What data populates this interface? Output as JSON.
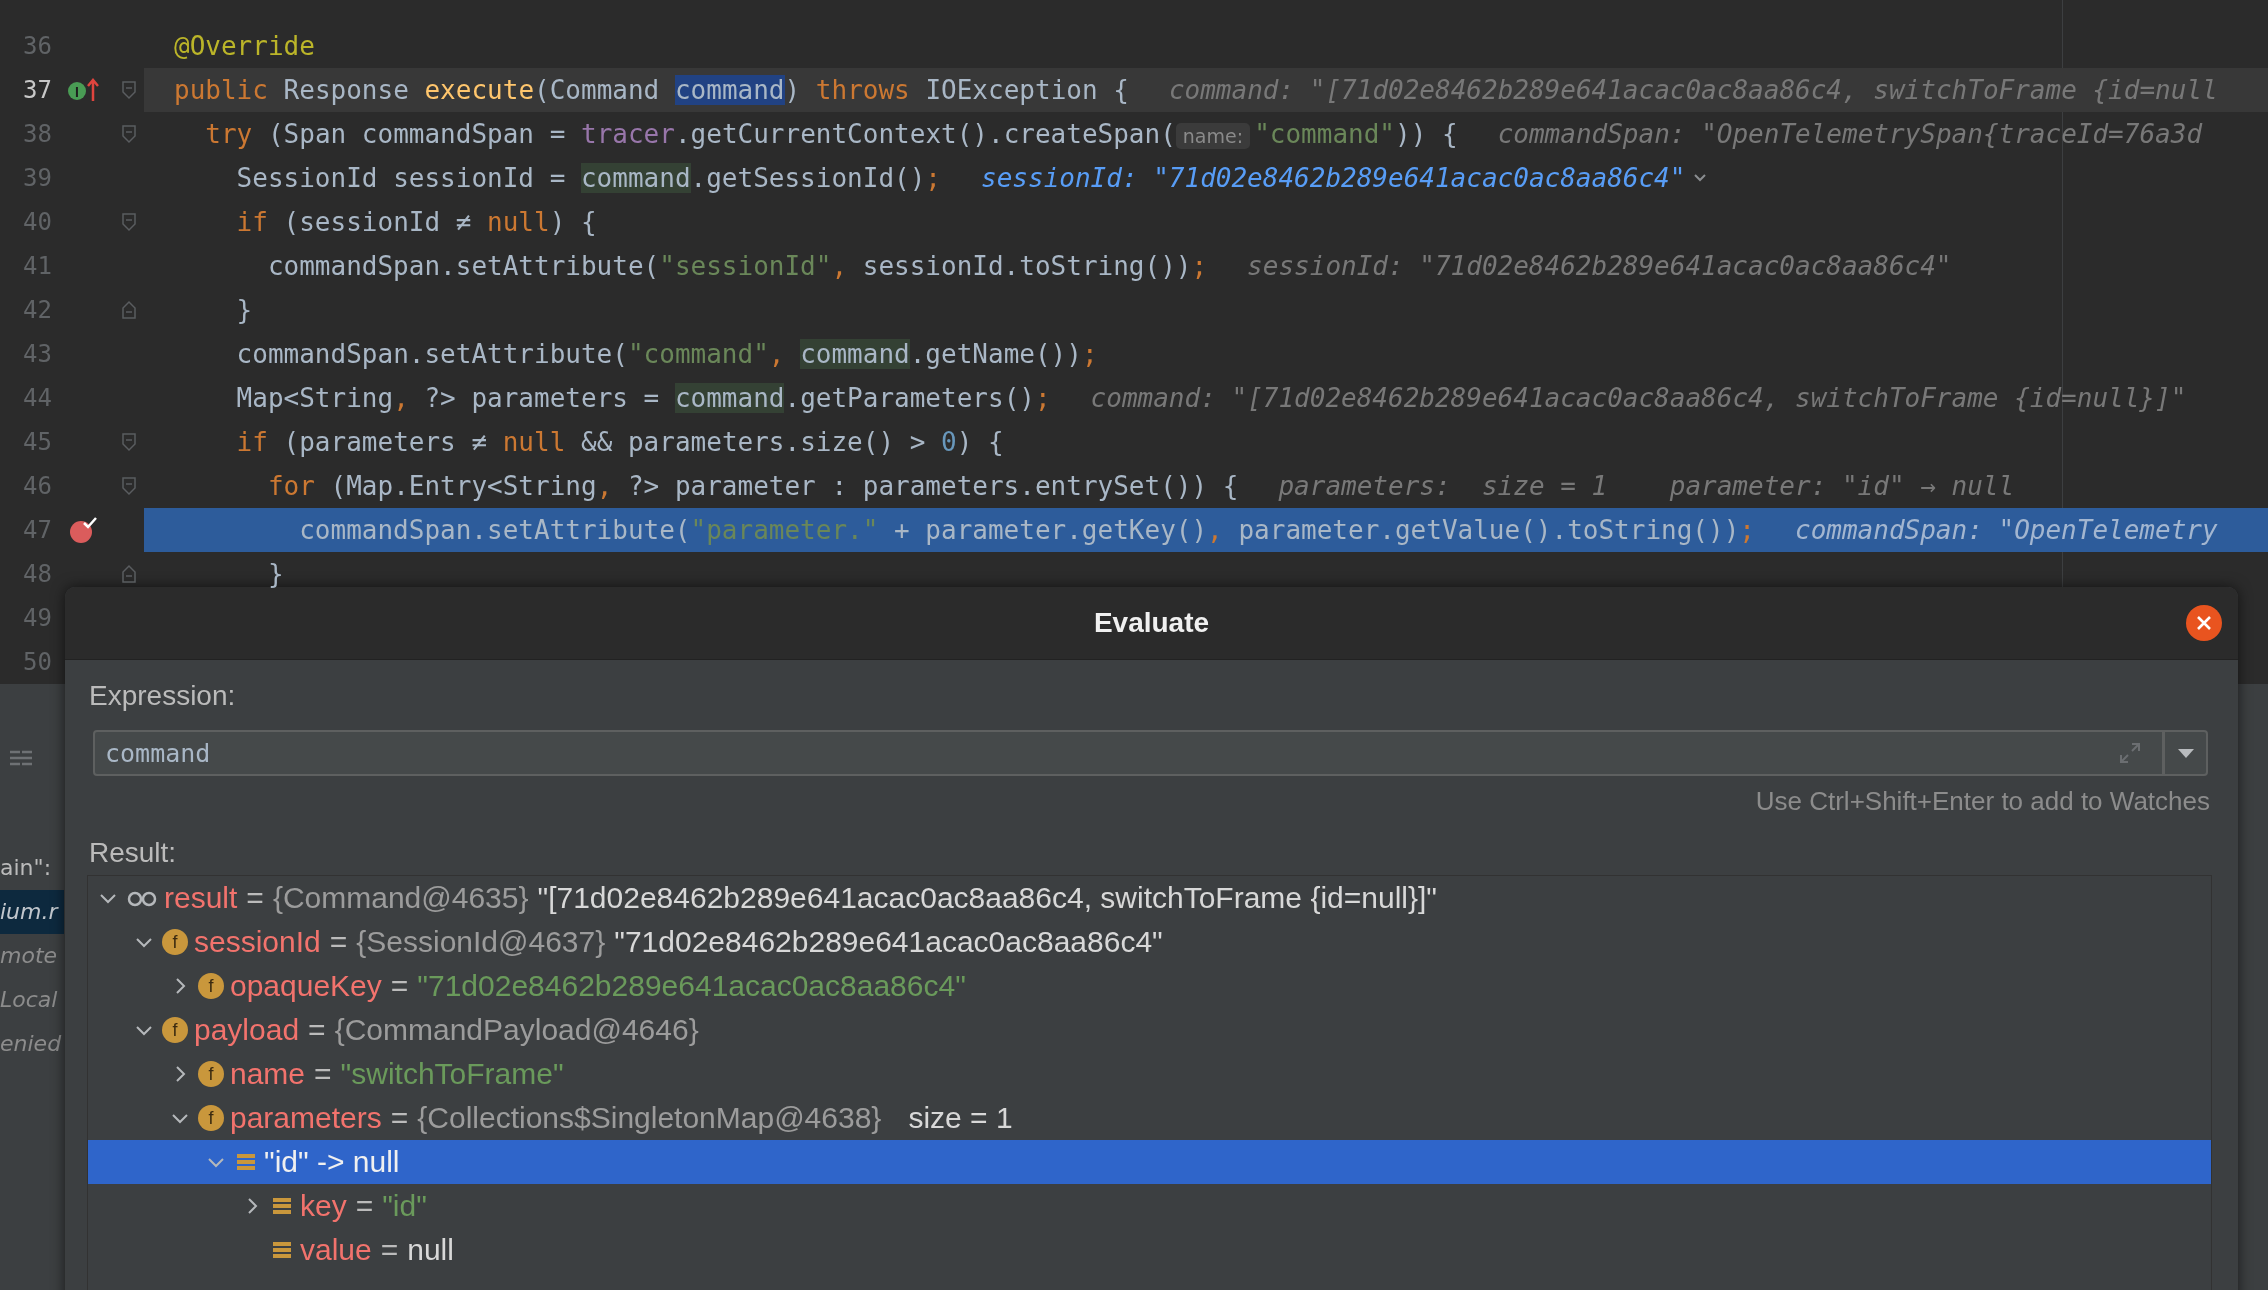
{
  "editor": {
    "lines": [
      {
        "number": "36",
        "selected": false,
        "caret_line": false,
        "tokens": [
          {
            "kind": "annot",
            "t": "@Override"
          }
        ]
      },
      {
        "number": "37",
        "selected": false,
        "caret_line": true,
        "gutter": {
          "kind": "implements",
          "letter": "I"
        },
        "fold": {
          "kind": "start"
        },
        "tokens": [
          {
            "kind": "kw",
            "t": "public"
          },
          {
            "kind": "plain",
            "t": " Response "
          },
          {
            "kind": "method",
            "t": "execute"
          },
          {
            "kind": "plain",
            "t": "(Command "
          },
          {
            "kind": "sel",
            "t": "command"
          },
          {
            "kind": "plain",
            "t": ") "
          },
          {
            "kind": "kw",
            "t": "throws"
          },
          {
            "kind": "plain",
            "t": " IOException {"
          }
        ],
        "hint": {
          "kind": "gray",
          "text": "command: \"[71d02e8462b289e641acac0ac8aa86c4, switchToFrame {id=null"
        },
        "children": [
          {
            "number": "38",
            "selected": false,
            "caret_line": false,
            "fold": {
              "kind": "start"
            },
            "tokens": [
              {
                "kind": "kw",
                "t": "try"
              },
              {
                "kind": "plain",
                "t": " (Span commandSpan = "
              },
              {
                "kind": "field",
                "t": "tracer"
              },
              {
                "kind": "plain",
                "t": ".getCurrentContext().createSpan("
              },
              {
                "kind": "chip",
                "t": "name:"
              },
              {
                "kind": "str",
                "t": "\"command\""
              },
              {
                "kind": "plain",
                "t": ")) {"
              }
            ],
            "hint": {
              "kind": "gray",
              "text": "commandSpan: \"OpenTelemetrySpan{traceId=76a3d"
            },
            "children": [
              {
                "number": "39",
                "selected": false,
                "caret_line": false,
                "tokens": [
                  {
                    "kind": "plain",
                    "t": "SessionId sessionId = "
                  },
                  {
                    "kind": "hl",
                    "t": "command"
                  },
                  {
                    "kind": "plain",
                    "t": ".getSessionId()"
                  },
                  {
                    "kind": "punct",
                    "t": ";"
                  }
                ],
                "hint": {
                  "kind": "blue",
                  "text": "sessionId: \"71d02e8462b289e641acac0ac8aa86c4\""
                }
              },
              {
                "number": "40",
                "selected": false,
                "caret_line": false,
                "fold": {
                  "kind": "start"
                },
                "tokens": [
                  {
                    "kind": "kw",
                    "t": "if"
                  },
                  {
                    "kind": "plain",
                    "t": " (sessionId ≠ "
                  },
                  {
                    "kind": "kw",
                    "t": "null"
                  },
                  {
                    "kind": "plain",
                    "t": ") {"
                  }
                ],
                "children": [
                  {
                    "number": "41",
                    "selected": false,
                    "caret_line": false,
                    "tokens": [
                      {
                        "kind": "plain",
                        "t": "commandSpan.setAttribute("
                      },
                      {
                        "kind": "str",
                        "t": "\"sessionId\""
                      },
                      {
                        "kind": "punct",
                        "t": ","
                      },
                      {
                        "kind": "plain",
                        "t": " sessionId.toString())"
                      },
                      {
                        "kind": "punct",
                        "t": ";"
                      }
                    ],
                    "hint": {
                      "kind": "gray",
                      "text": "sessionId: \"71d02e8462b289e641acac0ac8aa86c4\""
                    }
                  }
                ]
              },
              {
                "number": "42",
                "selected": false,
                "caret_line": false,
                "fold": {
                  "kind": "end"
                },
                "tokens": [
                  {
                    "kind": "plain",
                    "t": "}"
                  }
                ]
              },
              {
                "number": "43",
                "selected": false,
                "caret_line": false,
                "tokens": [
                  {
                    "kind": "plain",
                    "t": "commandSpan.setAttribute("
                  },
                  {
                    "kind": "str",
                    "t": "\"command\""
                  },
                  {
                    "kind": "punct",
                    "t": ", "
                  },
                  {
                    "kind": "hl",
                    "t": "command"
                  },
                  {
                    "kind": "plain",
                    "t": ".getName())"
                  },
                  {
                    "kind": "punct",
                    "t": ";"
                  }
                ]
              },
              {
                "number": "44",
                "selected": false,
                "caret_line": false,
                "tokens": [
                  {
                    "kind": "plain",
                    "t": "Map<String"
                  },
                  {
                    "kind": "punct",
                    "t": ","
                  },
                  {
                    "kind": "plain",
                    "t": " ?> parameters = "
                  },
                  {
                    "kind": "hl",
                    "t": "command"
                  },
                  {
                    "kind": "plain",
                    "t": ".getParameters()"
                  },
                  {
                    "kind": "punct",
                    "t": ";"
                  }
                ],
                "hint": {
                  "kind": "gray",
                  "text": "command: \"[71d02e8462b289e641acac0ac8aa86c4, switchToFrame {id=null}]\""
                }
              },
              {
                "number": "45",
                "selected": false,
                "caret_line": false,
                "fold": {
                  "kind": "start"
                },
                "tokens": [
                  {
                    "kind": "kw",
                    "t": "if"
                  },
                  {
                    "kind": "plain",
                    "t": " (parameters ≠ "
                  },
                  {
                    "kind": "kw",
                    "t": "null"
                  },
                  {
                    "kind": "plain",
                    "t": " && parameters.size() > "
                  },
                  {
                    "kind": "num",
                    "t": "0"
                  },
                  {
                    "kind": "plain",
                    "t": ") {"
                  }
                ],
                "children": [
                  {
                    "number": "46",
                    "selected": false,
                    "caret_line": false,
                    "fold": {
                      "kind": "start"
                    },
                    "tokens": [
                      {
                        "kind": "kw",
                        "t": "for"
                      },
                      {
                        "kind": "plain",
                        "t": " (Map.Entry<String"
                      },
                      {
                        "kind": "punct",
                        "t": ","
                      },
                      {
                        "kind": "plain",
                        "t": " ?> parameter : parameters.entrySet()) {"
                      }
                    ],
                    "hint": {
                      "kind": "gray",
                      "text": "parameters:  size = 1    parameter: \"id\" → null"
                    },
                    "children": [
                      {
                        "number": "47",
                        "selected": true,
                        "caret_line": false,
                        "gutter": {
                          "kind": "breakpoint"
                        },
                        "tokens": [
                          {
                            "kind": "plain",
                            "t": "commandSpan.setAttribute("
                          },
                          {
                            "kind": "str",
                            "t": "\"parameter.\""
                          },
                          {
                            "kind": "plain",
                            "t": " + parameter.getKey()"
                          },
                          {
                            "kind": "punct",
                            "t": ","
                          },
                          {
                            "kind": "plain",
                            "t": " parameter.getValue().toString())"
                          },
                          {
                            "kind": "punct",
                            "t": ";"
                          }
                        ],
                        "hint": {
                          "kind": "gray",
                          "text": "commandSpan: \"OpenTelemetry"
                        }
                      }
                    ]
                  },
                  {
                    "number": "48",
                    "selected": false,
                    "caret_line": false,
                    "fold": {
                      "kind": "end"
                    },
                    "tokens": [
                      {
                        "kind": "plain",
                        "t": "}"
                      }
                    ]
                  }
                ]
              }
            ]
          }
        ]
      },
      {
        "number": "49",
        "selected": false,
        "caret_line": false
      },
      {
        "number": "50",
        "selected": false,
        "caret_line": false
      }
    ]
  },
  "side_panel": {
    "fragments": [
      {
        "text": "ain\":",
        "selected": false
      },
      {
        "text": "ium.r",
        "selected": true
      },
      {
        "text": "mote",
        "selected": false
      },
      {
        "text": "Local",
        "selected": false
      },
      {
        "text": "enied",
        "selected": false
      }
    ]
  },
  "dialog": {
    "title": "Evaluate",
    "expression_label": "Expression:",
    "expression": "command",
    "watch_hint": "Use Ctrl+Shift+Enter to add to Watches",
    "result_label": "Result:",
    "tree": [
      {
        "kind": "watch",
        "name": "result",
        "op": "=",
        "type": "{Command@4635}",
        "value": {
          "kind": "plain",
          "text": "\"[71d02e8462b289e641acac0ac8aa86c4, switchToFrame {id=null}]\""
        },
        "expandable": true,
        "expanded": true,
        "selected": false,
        "children": [
          {
            "kind": "field",
            "letter": "f",
            "name": "sessionId",
            "op": "=",
            "type": "{SessionId@4637}",
            "value": {
              "kind": "plain",
              "text": "\"71d02e8462b289e641acac0ac8aa86c4\""
            },
            "expandable": true,
            "expanded": true,
            "selected": false,
            "children": [
              {
                "kind": "field",
                "letter": "f",
                "name": "opaqueKey",
                "op": "=",
                "value": {
                  "kind": "string",
                  "text": "\"71d02e8462b289e641acac0ac8aa86c4\""
                },
                "expandable": true,
                "expanded": false,
                "selected": false
              }
            ]
          },
          {
            "kind": "field",
            "letter": "f",
            "name": "payload",
            "op": "=",
            "type": "{CommandPayload@4646}",
            "expandable": true,
            "expanded": true,
            "selected": false,
            "children": [
              {
                "kind": "field",
                "letter": "f",
                "name": "name",
                "op": "=",
                "value": {
                  "kind": "string",
                  "text": "\"switchToFrame\""
                },
                "expandable": true,
                "expanded": false,
                "selected": false
              },
              {
                "kind": "field",
                "letter": "f",
                "name": "parameters",
                "op": "=",
                "type": "{Collections$SingletonMap@4638}",
                "extra": "size = 1",
                "expandable": true,
                "expanded": true,
                "selected": false,
                "children": [
                  {
                    "kind": "entry",
                    "label": "\"id\" -> null",
                    "expandable": true,
                    "expanded": true,
                    "selected": true,
                    "children": [
                      {
                        "kind": "entry",
                        "name": "key",
                        "op": "=",
                        "value": {
                          "kind": "string",
                          "text": "\"id\""
                        },
                        "expandable": true,
                        "expanded": false,
                        "selected": false
                      },
                      {
                        "kind": "entry",
                        "name": "value",
                        "op": "=",
                        "value": {
                          "kind": "plain",
                          "text": "null"
                        },
                        "expandable": false,
                        "expanded": false,
                        "selected": false
                      }
                    ]
                  }
                ]
              }
            ]
          }
        ]
      }
    ]
  }
}
